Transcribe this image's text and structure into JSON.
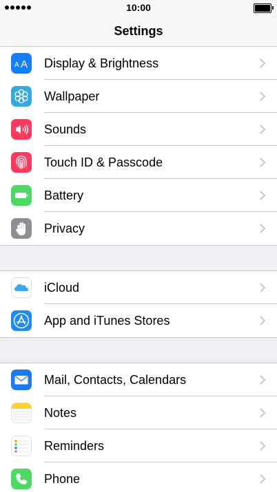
{
  "status_bar": {
    "time": "10:00"
  },
  "nav": {
    "title": "Settings"
  },
  "groups": [
    {
      "items": [
        {
          "label": "Display & Brightness",
          "icon": "display-brightness-icon",
          "color": "#147efb"
        },
        {
          "label": "Wallpaper",
          "icon": "wallpaper-icon",
          "color": "#35aadc"
        },
        {
          "label": "Sounds",
          "icon": "sounds-icon",
          "color": "#fd3b5e"
        },
        {
          "label": "Touch ID & Passcode",
          "icon": "fingerprint-icon",
          "color": "#fd3b5e"
        },
        {
          "label": "Battery",
          "icon": "battery-icon",
          "color": "#4cd964"
        },
        {
          "label": "Privacy",
          "icon": "hand-icon",
          "color": "#8e8e93"
        }
      ]
    },
    {
      "items": [
        {
          "label": "iCloud",
          "icon": "cloud-icon",
          "color": "#ffffff"
        },
        {
          "label": "App and iTunes Stores",
          "icon": "app-store-icon",
          "color": "#1e8bf5"
        }
      ]
    },
    {
      "items": [
        {
          "label": "Mail, Contacts, Calendars",
          "icon": "mail-icon",
          "color": "#1a7cf0"
        },
        {
          "label": "Notes",
          "icon": "notes-icon",
          "color": "#ffd033"
        },
        {
          "label": "Reminders",
          "icon": "reminders-icon",
          "color": "#ffffff"
        },
        {
          "label": "Phone",
          "icon": "phone-icon",
          "color": "#4cd964"
        }
      ]
    }
  ]
}
